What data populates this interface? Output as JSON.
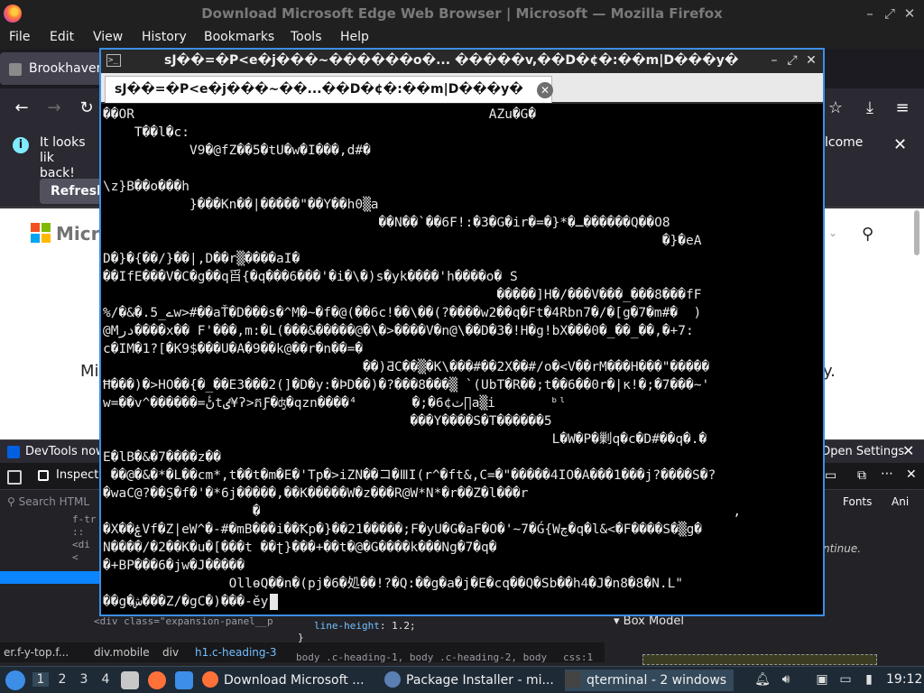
{
  "firefox": {
    "window_title": "Download Microsoft Edge Web Browser | Microsoft — Mozilla Firefox",
    "menu": [
      {
        "label": "File"
      },
      {
        "label": "Edit"
      },
      {
        "label": "View"
      },
      {
        "label": "History"
      },
      {
        "label": "Bookmarks"
      },
      {
        "label": "Tools"
      },
      {
        "label": "Help"
      }
    ],
    "tab_label": "Brookhaven",
    "notification": {
      "text_left": "It looks lik",
      "text_left2": "back!",
      "text_right": "lcome",
      "refresh_label": "Refresh"
    },
    "page": {
      "brand_fragment": "Micro",
      "heading_fragment": "Mi",
      "heading_end": "y."
    },
    "devtools_bar": {
      "text": "DevTools now f",
      "open_settings": "Open Settings"
    },
    "devtools": {
      "inspector_tab": "Inspecto",
      "search_placeholder": "Search HTML",
      "fonts_tab": "Fonts",
      "anim_tab": "Ani",
      "continue_text": "ntinue.",
      "tree_rows": [
        "f-tr",
        ":: ",
        "<di",
        "<",
        "",
        "",
        "",
        "",
        ""
      ],
      "tree_last": "<div class=\"expansion-panel__p",
      "rule_line_prop": "line-height",
      "rule_line_val": "1.2;",
      "rule_close": "}",
      "box_model_label": "Box Model",
      "breadcrumb": [
        "er.f-y-top.f...",
        "div.mobile",
        "div",
        "h1.c-heading-3"
      ],
      "selectors": "body .c-heading-1, body .c-heading-2, body",
      "css_loc": "css:1"
    }
  },
  "qterminal": {
    "window_title": "sJ��=�P<e�j���~������o�...  �����v,��D�¢�:��m|D���y�",
    "tab_label": "sJ��=�P<e�j���~��...��D�¢�:��m|D���y�",
    "lines": [
      {
        "col": 0,
        "text": "��OR                                             AZu�G�"
      },
      {
        "col": 4,
        "text": "T��l�c:"
      },
      {
        "col": 11,
        "text": "V9�@fZ��5�tU�w�I���,d#�"
      },
      {
        "col": 0,
        "text": ""
      },
      {
        "col": 0,
        "text": "\\z}B��o���h"
      },
      {
        "col": 11,
        "text": "}���Kn��|�����\"��Y��h0▒a"
      },
      {
        "col": 35,
        "text": "��N��`��6F!:�3�G�ir�=�}*�ـ������Q��O8"
      },
      {
        "col": 71,
        "text": "�}�eA"
      },
      {
        "col": 0,
        "text": "D�}�{��/}��|,D��r▒����aI�"
      },
      {
        "col": 0,
        "text": "��IfE���V�C�g��q㸓{�q���6���'�i�\\�)s�yk����'h����o� S"
      },
      {
        "col": 50,
        "text": "�����]H�/���V���_���8���fF"
      },
      {
        "col": 0,
        "text": "%/�&�.5_ےw>#��aŤ�D���s�^M�~�f�@(��6c!��\\��(?����w2��q�Ft�4Rbn7�/�[g�7�m#�  )"
      },
      {
        "col": 0,
        "text": "@Mدر����x�� F'���,m:�L(���&�����@�\\�>����V�n@\\��D�3�!H�g!bX���0�_��_��,�+7:"
      },
      {
        "col": 0,
        "text": "c�IM�1?[�K9$���U�A�9��k@��r�n��=�"
      },
      {
        "col": 33,
        "text": "��)ƋC��▒�K\\���#��2X��#/o�<V��rM���H���\"�����"
      },
      {
        "col": 0,
        "text": "Ħ���)�>HO��{�_��E3���2(]�D�y:�ÞD��)�?���8���▒ `(UbT�R��;t��6��0r�|κ!�;�7���~'"
      },
      {
        "col": 0,
        "text": "w=��v^������=ڻٔtٸ¥ʔ>ភƑ�ʤ�qzn����ٽ¢6�;�       ⁴∏a▒i       ᵇˡ"
      },
      {
        "col": 39,
        "text": "���Y����S�T������5"
      },
      {
        "col": 57,
        "text": "L�W�P�剿q�c�D#��q�.�"
      },
      {
        "col": 0,
        "text": "E�lB�&�7����z��"
      },
      {
        "col": 1,
        "text": "��@�&�*�L��cm*,t��t�m�E�'Tp�>iZN��コ�ⅢI(r^�ft&,C=�\"�����4IO�A���1���j?����S�?"
      },
      {
        "col": 0,
        "text": "�waC@?��Ş�f�'�*6j�����,��K�����W�z���R@W*N*�r��Z�l���r"
      },
      {
        "col": 0,
        "text": "                   �                                                            ,"
      },
      {
        "col": 0,
        "text": "�X��ۼVf�Z|eW^�-#�mB���i��Ꝁp�}��21�����;F�yU�G�aF�O�'~7�Ǵ{Wچ�q�l&<�F����S�▒g�"
      },
      {
        "col": 0,
        "text": "N����/�2��K�u�[���t ��ʈ}���+��t�@�G����k���Ng�7�q�"
      },
      {
        "col": 0,
        "text": "�+BP���6�jw�J�����"
      },
      {
        "col": 16,
        "text": "OllɵQ��n�(pj�6�処��!?�Q:��g�a�j�E�cq��Q�Sb��h4�J�n8�8�N.L\""
      },
      {
        "col": 0,
        "text": "��g�ش���Z/�gC�)���-ěy"
      }
    ]
  },
  "taskbar": {
    "workspaces": [
      "1",
      "2",
      "3",
      "4"
    ],
    "apps": [
      {
        "label": "Download Microsoft ..."
      },
      {
        "label": "Package Installer - mi..."
      },
      {
        "label": "qterminal - 2 windows"
      }
    ],
    "clock": "19:12"
  }
}
